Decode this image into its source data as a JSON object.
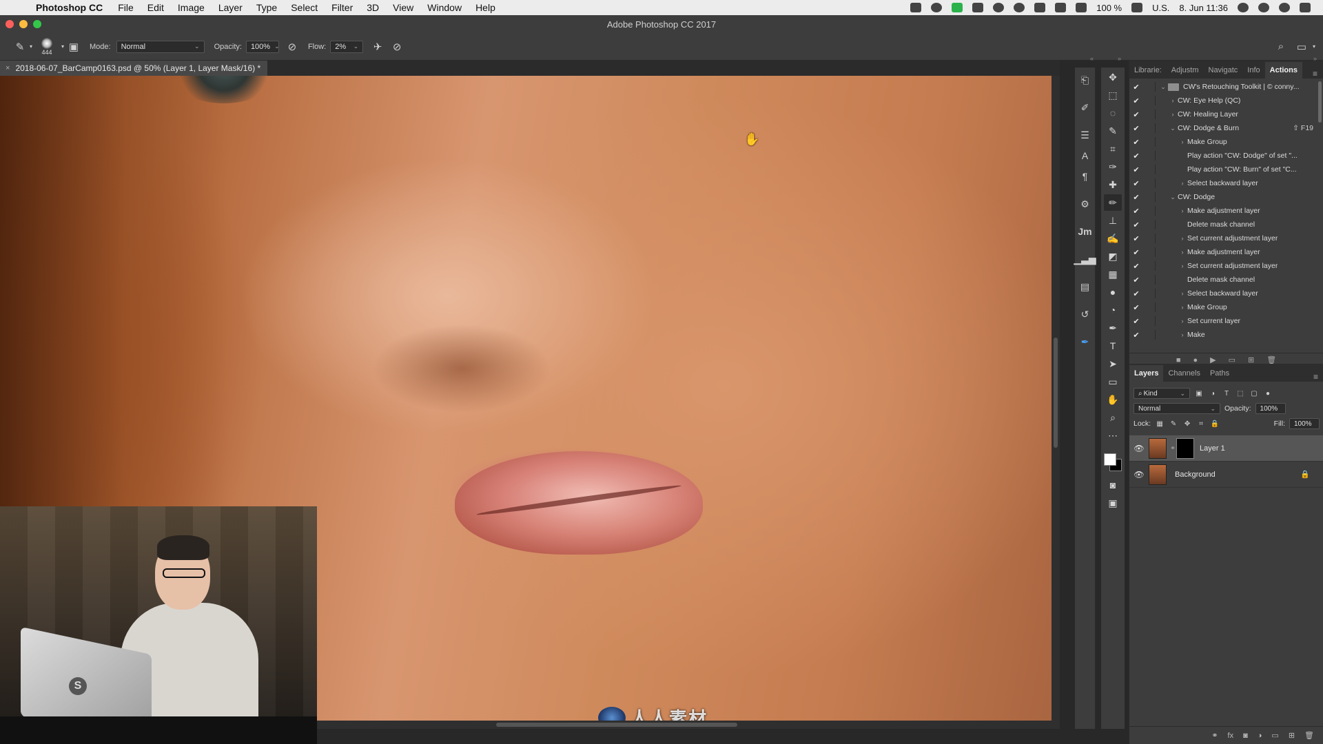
{
  "menubar": {
    "app": "Photoshop CC",
    "items": [
      "File",
      "Edit",
      "Image",
      "Layer",
      "Type",
      "Select",
      "Filter",
      "3D",
      "View",
      "Window",
      "Help"
    ],
    "battery": "100 %",
    "locale": "U.S.",
    "datetime": "8. Jun 11:36"
  },
  "window": {
    "title": "Adobe Photoshop CC 2017"
  },
  "options": {
    "brush_size": "444",
    "mode_label": "Mode:",
    "mode_value": "Normal",
    "opacity_label": "Opacity:",
    "opacity_value": "100%",
    "flow_label": "Flow:",
    "flow_value": "2%"
  },
  "document": {
    "tab_title": "2018-06-07_BarCamp0163.psd @ 50% (Layer 1, Layer Mask/16) *"
  },
  "watermark": {
    "text": "人人素材"
  },
  "panel_tabs": [
    "Librarie:",
    "Adjustm",
    "Navigatc",
    "Info",
    "Actions"
  ],
  "actions": [
    {
      "label": "CW's Retouching Toolkit | © conny...",
      "twirl": "⌄",
      "type": "set",
      "indent": 0,
      "shortcut": ""
    },
    {
      "label": "CW: Eye Help (QC)",
      "twirl": "›",
      "type": "action",
      "indent": 1,
      "shortcut": ""
    },
    {
      "label": "CW: Healing Layer",
      "twirl": "›",
      "type": "action",
      "indent": 1,
      "shortcut": ""
    },
    {
      "label": "CW: Dodge & Burn",
      "twirl": "⌄",
      "type": "action",
      "indent": 1,
      "shortcut": "⇧ F19"
    },
    {
      "label": "Make Group",
      "twirl": "›",
      "type": "step",
      "indent": 2,
      "shortcut": ""
    },
    {
      "label": "Play action \"CW: Dodge\" of set \"...",
      "twirl": "",
      "type": "step",
      "indent": 2,
      "shortcut": ""
    },
    {
      "label": "Play action \"CW: Burn\" of set \"C...",
      "twirl": "",
      "type": "step",
      "indent": 2,
      "shortcut": ""
    },
    {
      "label": "Select backward layer",
      "twirl": "›",
      "type": "step",
      "indent": 2,
      "shortcut": ""
    },
    {
      "label": "CW: Dodge",
      "twirl": "⌄",
      "type": "action",
      "indent": 1,
      "shortcut": ""
    },
    {
      "label": "Make adjustment layer",
      "twirl": "›",
      "type": "step",
      "indent": 2,
      "shortcut": ""
    },
    {
      "label": "Delete mask channel",
      "twirl": "",
      "type": "step",
      "indent": 2,
      "shortcut": ""
    },
    {
      "label": "Set current adjustment layer",
      "twirl": "›",
      "type": "step",
      "indent": 2,
      "shortcut": ""
    },
    {
      "label": "Make adjustment layer",
      "twirl": "›",
      "type": "step",
      "indent": 2,
      "shortcut": ""
    },
    {
      "label": "Set current adjustment layer",
      "twirl": "›",
      "type": "step",
      "indent": 2,
      "shortcut": ""
    },
    {
      "label": "Delete mask channel",
      "twirl": "",
      "type": "step",
      "indent": 2,
      "shortcut": ""
    },
    {
      "label": "Select backward layer",
      "twirl": "›",
      "type": "step",
      "indent": 2,
      "shortcut": ""
    },
    {
      "label": "Make Group",
      "twirl": "›",
      "type": "step",
      "indent": 2,
      "shortcut": ""
    },
    {
      "label": "Set current layer",
      "twirl": "›",
      "type": "step",
      "indent": 2,
      "shortcut": ""
    },
    {
      "label": "Make",
      "twirl": "›",
      "type": "step",
      "indent": 2,
      "shortcut": ""
    }
  ],
  "layers_tabs": [
    "Layers",
    "Channels",
    "Paths"
  ],
  "layers": {
    "filter_label": "Kind",
    "blend_mode": "Normal",
    "opacity_label": "Opacity:",
    "opacity_value": "100%",
    "lock_label": "Lock:",
    "fill_label": "Fill:",
    "fill_value": "100%",
    "items": [
      {
        "name": "Layer 1",
        "has_mask": true,
        "selected": true,
        "locked": false
      },
      {
        "name": "Background",
        "has_mask": false,
        "selected": false,
        "locked": true
      }
    ]
  },
  "colors": {
    "panel_bg": "#3d3d3d",
    "dark_bg": "#282828",
    "selected_layer": "#565656",
    "accent": "#4aa4ff"
  },
  "icons": {
    "left_column": [
      "history-icon",
      "brush-settings-icon",
      "layer-comps-icon",
      "character-icon",
      "paragraph-icon",
      "properties-icon",
      "jm-plugin-icon",
      "histogram-icon",
      "timeline-icon",
      "history-states-icon",
      "pen-pressure-icon"
    ],
    "toolbox": [
      "move-tool-icon",
      "marquee-tool-icon",
      "lasso-tool-icon",
      "quick-select-tool-icon",
      "crop-tool-icon",
      "eyedropper-tool-icon",
      "healing-brush-tool-icon",
      "brush-tool-icon",
      "clone-stamp-tool-icon",
      "history-brush-tool-icon",
      "eraser-tool-icon",
      "gradient-tool-icon",
      "blur-tool-icon",
      "dodge-tool-icon",
      "pen-tool-icon",
      "type-tool-icon",
      "path-selection-tool-icon",
      "rectangle-tool-icon",
      "hand-tool-icon",
      "zoom-tool-icon",
      "more-tools-icon"
    ]
  }
}
